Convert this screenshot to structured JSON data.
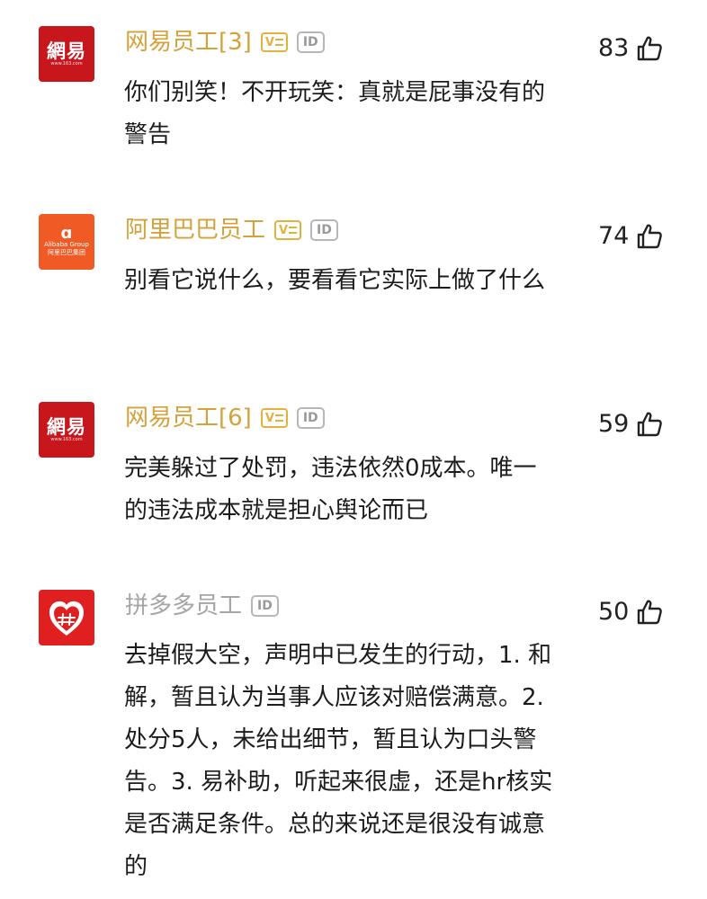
{
  "comments": [
    {
      "avatar_text": "網易",
      "avatar_sub": "www.163.com",
      "user": "网易员工[3]",
      "likes": "83",
      "text": "你们别笑！不开玩笑：真就是屁事没有的警告"
    },
    {
      "avatar_text": "Alibaba Group",
      "avatar_sub": "阿里巴巴集团",
      "user": "阿里巴巴员工",
      "likes": "74",
      "text": "别看它说什么，要看看它实际上做了什么"
    },
    {
      "avatar_text": "網易",
      "avatar_sub": "www.163.com",
      "user": "网易员工[6]",
      "likes": "59",
      "text": "完美躲过了处罚，违法依然0成本。唯一的违法成本就是担心舆论而已"
    },
    {
      "user": "拼多多员工",
      "likes": "50",
      "text": "去掉假大空，声明中已发生的行动，1. 和解，暂且认为当事人应该对赔偿满意。2. 处分5人，未给出细节，暂且认为口头警告。3. 易补助，听起来很虚，还是hr核实是否满足条件。总的来说还是很没有诚意的"
    }
  ],
  "badges": {
    "id_label": "ID"
  },
  "colors": {
    "verified_gold": "#d4a23a",
    "plain_gray": "#a5a5a5",
    "netease_red": "#c8161d",
    "alibaba_orange": "#f05a24",
    "pdd_red": "#e02020"
  },
  "icons": {
    "like": "thumbs-up-icon",
    "verified": "verified-badge-icon"
  }
}
